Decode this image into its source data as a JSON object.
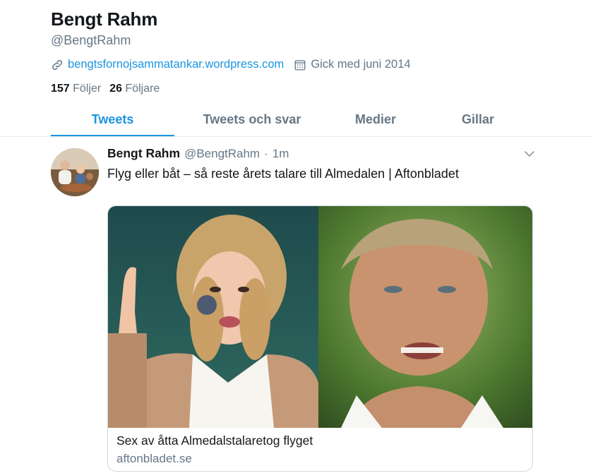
{
  "profile": {
    "name": "Bengt Rahm",
    "handle": "@BengtRahm",
    "website": "bengtsfornojsammatankar.wordpress.com",
    "joined": "Gick med juni 2014"
  },
  "counts": {
    "following_num": "157",
    "following_label": "Följer",
    "followers_num": "26",
    "followers_label": "Följare"
  },
  "tabs": [
    {
      "label": "Tweets",
      "active": true
    },
    {
      "label": "Tweets och svar",
      "active": false
    },
    {
      "label": "Medier",
      "active": false
    },
    {
      "label": "Gillar",
      "active": false
    }
  ],
  "tweet": {
    "author_name": "Bengt Rahm",
    "author_handle": "@BengtRahm",
    "separator": "·",
    "time": "1m",
    "text": "Flyg eller båt – så reste årets talare till Almedalen | Aftonbladet",
    "card": {
      "title": "Sex av åtta Almedalstalaretog flyget",
      "domain": "aftonbladet.se"
    }
  },
  "colors": {
    "accent": "#1b95e0",
    "secondary_text": "#657786",
    "primary_text": "#14171a",
    "border": "#e6ecf0"
  },
  "icons": {
    "website": "link-icon",
    "joined": "calendar-icon",
    "menu": "chevron-down-icon"
  }
}
